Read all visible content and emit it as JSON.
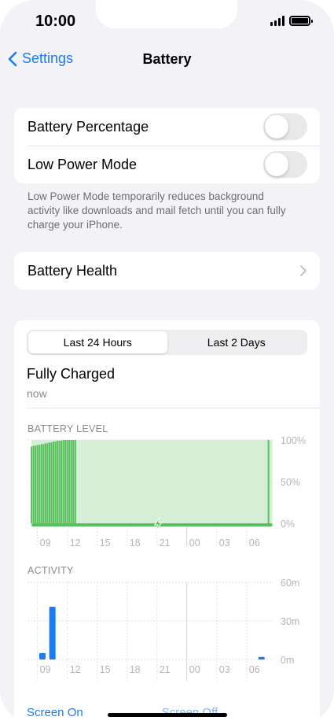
{
  "status_bar": {
    "time": "10:00"
  },
  "nav": {
    "back_label": "Settings",
    "title": "Battery"
  },
  "settings_group": {
    "battery_percentage": {
      "label": "Battery Percentage",
      "enabled": false
    },
    "low_power_mode": {
      "label": "Low Power Mode",
      "enabled": false
    }
  },
  "footnote": "Low Power Mode temporarily reduces background activity like downloads and mail fetch until you can fully charge your iPhone.",
  "battery_health": {
    "label": "Battery Health"
  },
  "usage": {
    "tabs": [
      {
        "label": "Last 24 Hours",
        "selected": true
      },
      {
        "label": "Last 2 Days",
        "selected": false
      }
    ],
    "charge_state": "Fully Charged",
    "charge_time": "now"
  },
  "colors": {
    "accent": "#1a7cf5",
    "battery_green": "#5ac05e",
    "battery_fill": "#d4efd5",
    "activity_blue": "#1a7cf5"
  },
  "chart_data": [
    {
      "type": "bar",
      "title": "BATTERY LEVEL",
      "x_ticks": [
        "09",
        "12",
        "15",
        "18",
        "21",
        "00",
        "03",
        "06"
      ],
      "y_ticks": [
        "100%",
        "50%",
        "0%"
      ],
      "ylim": [
        0,
        100
      ],
      "hours": [
        8.4,
        8.6,
        8.8,
        9.0,
        9.2,
        9.4,
        9.6,
        9.8,
        10.0,
        10.2,
        10.4,
        10.6,
        10.8,
        11.0,
        11.2,
        11.4,
        11.6,
        11.8,
        12.0,
        12.2,
        12.4,
        12.6,
        12.8,
        13.0,
        13.2,
        13.4,
        13.6,
        13.8,
        14.0,
        14.2,
        14.4,
        14.6,
        14.8,
        15.0,
        15.2,
        15.4,
        15.6,
        15.8,
        16.0,
        16.2,
        16.4,
        16.6,
        16.8,
        17.0,
        17.2,
        17.4,
        17.6,
        17.8,
        18.0,
        18.2,
        18.4,
        18.6,
        18.8,
        19.0,
        19.2,
        19.4,
        19.6,
        19.8,
        20.0,
        20.2,
        20.4,
        20.6,
        20.8,
        21.0,
        21.2,
        21.4,
        21.6,
        21.8,
        22.0,
        22.2,
        22.4,
        22.6,
        22.8,
        23.0,
        23.2,
        23.4,
        23.6,
        23.8,
        24.0,
        24.2,
        24.4,
        24.6,
        24.8,
        25.0,
        25.2,
        25.4,
        25.6,
        25.8,
        26.0,
        26.2,
        26.4,
        26.6,
        26.8,
        27.0,
        27.2,
        27.4,
        27.6,
        27.8,
        28.0,
        28.2,
        28.4,
        28.6,
        28.8,
        29.0,
        29.2,
        29.4,
        29.6,
        29.8,
        30.0,
        30.2,
        30.4,
        30.6,
        30.8,
        31.0,
        31.2,
        31.4,
        31.6,
        31.8,
        32.0,
        32.2,
        32.4,
        32.6
      ],
      "values": [
        92,
        93,
        93,
        94,
        94,
        95,
        95,
        96,
        96,
        97,
        97,
        98,
        98,
        99,
        99,
        99,
        100,
        100,
        100,
        100,
        100,
        100,
        100,
        100,
        100,
        100,
        100,
        100,
        100,
        100,
        100,
        100,
        100,
        100,
        100,
        100,
        100,
        100,
        100,
        100,
        100,
        100,
        100,
        100,
        100,
        100,
        100,
        100,
        100,
        100,
        100,
        100,
        100,
        100,
        100,
        100,
        100,
        100,
        100,
        100,
        100,
        100,
        100,
        100,
        100,
        100,
        100,
        100,
        100,
        100,
        100,
        100,
        100,
        100,
        100,
        100,
        100,
        100,
        100,
        100,
        100,
        100,
        100,
        100,
        100,
        100,
        100,
        100,
        100,
        100,
        100,
        100,
        100,
        100,
        100,
        100,
        100,
        100,
        100,
        100,
        100,
        100,
        100,
        100,
        100,
        100,
        100,
        100,
        100,
        100,
        100,
        100,
        100,
        100,
        100,
        100,
        100,
        100,
        100,
        100
      ]
    },
    {
      "type": "bar",
      "title": "ACTIVITY",
      "x_ticks": [
        "09",
        "12",
        "15",
        "18",
        "21",
        "00",
        "03",
        "06"
      ],
      "y_ticks": [
        "60m",
        "30m",
        "0m"
      ],
      "ylim": [
        0,
        60
      ],
      "bars": [
        {
          "hour": 9.5,
          "screen_on": 5
        },
        {
          "hour": 10.5,
          "screen_on": 41
        },
        {
          "hour": 31.5,
          "screen_on": 2
        }
      ],
      "legend": [
        "Screen On",
        "Screen Off"
      ]
    }
  ]
}
